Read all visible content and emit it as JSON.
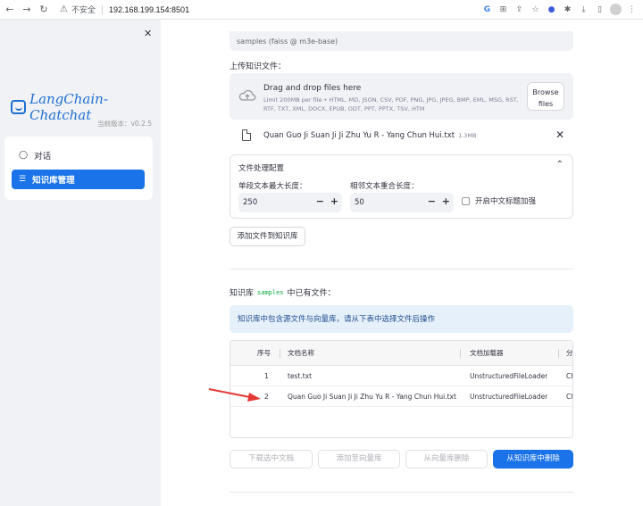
{
  "browser": {
    "insecure_label": "不安全",
    "url": "192.168.199.154:8501"
  },
  "sidebar": {
    "app_name": "LangChain-Chatchat",
    "version": "当前版本：v0.2.5",
    "items": [
      {
        "label": "对话"
      },
      {
        "label": "知识库管理"
      }
    ]
  },
  "main": {
    "kb_select_partial": "samples (faiss @ m3e-base)",
    "upload_label": "上传知识文件：",
    "dropzone": {
      "title": "Drag and drop files here",
      "subtitle": "Limit 200MB per file • HTML, MD, JSON, CSV, PDF, PNG, JPG, JPEG, BMP, EML, MSG, RST, RTF, TXT, XML, DOCX, EPUB, ODT, PPT, PPTX, TSV, HTM",
      "browse_label": "Browse files"
    },
    "uploaded_file": {
      "name": "Quan Guo Ji Suan Ji Ji Zhu Yu R - Yang Chun Hui.txt",
      "size": "1.3MB"
    },
    "processing": {
      "title": "文件处理配置",
      "chunk_size_label": "单段文本最大长度：",
      "chunk_size_value": "250",
      "overlap_label": "相邻文本重合长度：",
      "overlap_value": "50",
      "zh_title_label": "开启中文标题加强"
    },
    "add_button": "添加文件到知识库",
    "kb_heading_prefix": "知识库",
    "kb_heading_code": "samples",
    "kb_heading_suffix": "中已有文件：",
    "info_text": "知识库中包含源文件与向量库，请从下表中选择文件后操作",
    "table": {
      "columns": [
        "序号",
        "文档名称",
        "文档加载器",
        "分"
      ],
      "rows": [
        {
          "no": "1",
          "name": "test.txt",
          "loader": "UnstructuredFileLoader",
          "extra": "Ch"
        },
        {
          "no": "2",
          "name": "Quan Guo Ji Suan Ji Ji Zhu Yu R - Yang Chun Hui.txt",
          "loader": "UnstructuredFileLoader",
          "extra": "Ch"
        }
      ]
    },
    "buttons": {
      "download": "下载选中文档",
      "add_to_vs": "添加至向量库",
      "remove_from_vs": "从向量库删除",
      "delete_from_kb": "从知识库中删除"
    }
  },
  "colors": {
    "primary": "#1a73e8",
    "sidebar_bg": "#f0f2f6",
    "arrow": "#e53935"
  }
}
